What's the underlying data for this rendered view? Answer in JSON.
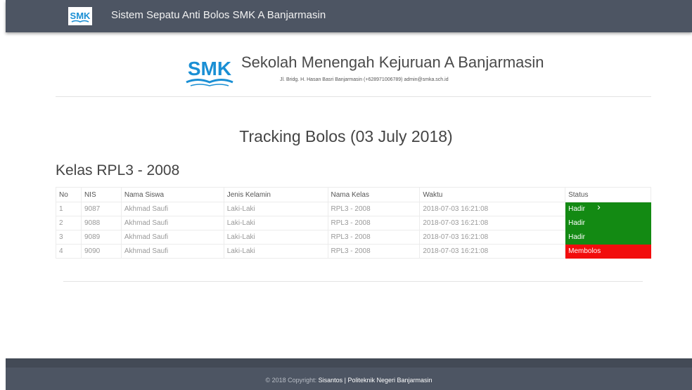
{
  "navbar": {
    "logo_text": "SMK",
    "title": "Sistem Sepatu Anti Bolos SMK A Banjarmasin"
  },
  "header": {
    "logo_text": "SMK",
    "school_name": "Sekolah Menengah Kejuruan A Banjarmasin",
    "address": "Jl. Bridg. H. Hasan Basri Banjarmasin (+628971006789) admin@smka.sch.id"
  },
  "page_title": "Tracking Bolos (03 July 2018)",
  "class_title": "Kelas RPL3 - 2008",
  "table": {
    "headers": [
      "No",
      "NIS",
      "Nama Siswa",
      "Jenis Kelamin",
      "Nama Kelas",
      "Waktu",
      "Status"
    ],
    "rows": [
      [
        "1",
        "9087",
        "Akhmad Saufi",
        "Laki-Laki",
        "RPL3 - 2008",
        "2018-07-03 16:21:08",
        "Hadir"
      ],
      [
        "2",
        "9088",
        "Akhmad Saufi",
        "Laki-Laki",
        "RPL3 - 2008",
        "2018-07-03 16:21:08",
        "Hadir"
      ],
      [
        "3",
        "9089",
        "Akhmad Saufi",
        "Laki-Laki",
        "RPL3 - 2008",
        "2018-07-03 16:21:08",
        "Hadir"
      ],
      [
        "4",
        "9090",
        "Akhmad Saufi",
        "Laki-Laki",
        "RPL3 - 2008",
        "2018-07-03 16:21:08",
        "Membolos"
      ]
    ]
  },
  "status_colors": {
    "Hadir": "#138a13",
    "Membolos": "#f20d0d"
  },
  "colors": {
    "navbar": "#4d5563",
    "logo_blue": "#1a8fd4"
  },
  "footer": {
    "prefix": "© 2018 Copyright:",
    "highlight": "Sisantos | Politeknik Negeri Banjarmasin"
  }
}
